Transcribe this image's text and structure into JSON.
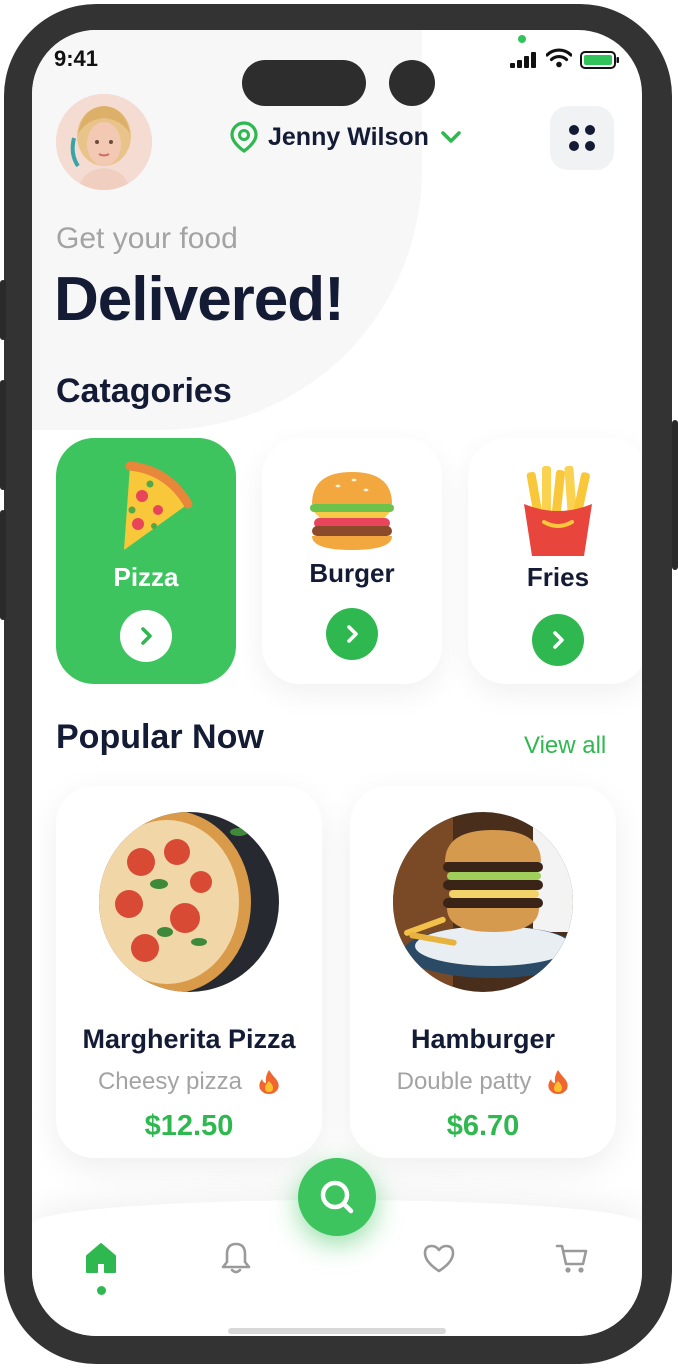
{
  "status_bar": {
    "time": "9:41"
  },
  "header": {
    "location_name": "Jenny Wilson"
  },
  "hero": {
    "subtitle": "Get your food",
    "headline": "Delivered!"
  },
  "categories": {
    "title": "Catagories",
    "items": [
      {
        "label": "Pizza",
        "icon": "pizza-slice-icon",
        "selected": true
      },
      {
        "label": "Burger",
        "icon": "burger-icon",
        "selected": false
      },
      {
        "label": "Fries",
        "icon": "fries-icon",
        "selected": false
      }
    ]
  },
  "popular": {
    "title": "Popular Now",
    "view_all": "View all",
    "items": [
      {
        "name": "Margherita Pizza",
        "desc": "Cheesy pizza",
        "price": "$12.50",
        "badge_icon": "fire-icon"
      },
      {
        "name": "Hamburger",
        "desc": "Double patty",
        "price": "$6.70",
        "badge_icon": "fire-icon"
      }
    ]
  },
  "bottom_nav": {
    "items": [
      "home-icon",
      "bell-icon",
      "search-icon",
      "heart-icon",
      "cart-icon"
    ],
    "active": "home-icon"
  },
  "colors": {
    "accent": "#3ec45e",
    "accent_dark": "#2fb84f",
    "heading": "#141b34",
    "muted": "#a3a3a3",
    "frame": "#333333"
  }
}
